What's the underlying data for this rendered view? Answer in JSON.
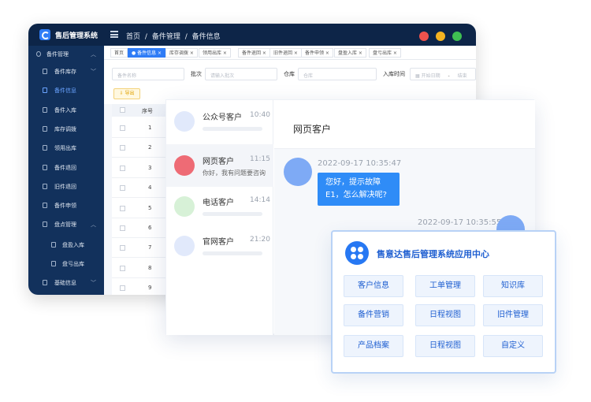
{
  "admin": {
    "app_title": "售后管理系统",
    "breadcrumb": [
      "首页",
      "/",
      "备件管理",
      "/",
      "备件信息"
    ],
    "window_dots": [
      "#f0524d",
      "#f5b321",
      "#3fbf52"
    ],
    "sidebar": [
      {
        "label": "备件管理",
        "level": "group",
        "chevron": "︿"
      },
      {
        "label": "备件库存",
        "level": "item",
        "chevron": "﹀"
      },
      {
        "label": "备件信息",
        "level": "item",
        "active": true
      },
      {
        "label": "备件入库",
        "level": "item"
      },
      {
        "label": "库存调拨",
        "level": "item"
      },
      {
        "label": "领用出库",
        "level": "item"
      },
      {
        "label": "备件退回",
        "level": "item"
      },
      {
        "label": "旧件退回",
        "level": "item"
      },
      {
        "label": "备件申领",
        "level": "item"
      },
      {
        "label": "盘点管理",
        "level": "item",
        "chevron": "︿"
      },
      {
        "label": "盘盈入库",
        "level": "sub"
      },
      {
        "label": "盘亏出库",
        "level": "sub"
      },
      {
        "label": "基础信息",
        "level": "item",
        "chevron": "﹀"
      }
    ],
    "tabs": [
      {
        "label": "首页"
      },
      {
        "label": "● 备件信息 ×",
        "active": true
      },
      {
        "label": "库存调拨 ×"
      },
      {
        "label": "领用出库 ×"
      },
      {
        "label": "备件退回 ×"
      },
      {
        "label": "旧件退回 ×"
      },
      {
        "label": "备件申领 ×"
      },
      {
        "label": "盘盈入库 ×"
      },
      {
        "label": "盘亏出库 ×"
      }
    ],
    "filters": {
      "part_name_placeholder": "备件名称",
      "batch_label": "批次",
      "batch_placeholder": "请输入批次",
      "warehouse_label": "仓库",
      "warehouse_placeholder": "仓库",
      "inbound_time_label": "入库时间",
      "start_date_placeholder": "开始日期",
      "range_sep": "-",
      "end_date_placeholder": "结束"
    },
    "export_label": "⇩ 导出",
    "table": {
      "header_no": "序号",
      "rows": [
        "1",
        "2",
        "3",
        "4",
        "5",
        "6",
        "7",
        "8",
        "9"
      ]
    }
  },
  "chat": {
    "conversations": [
      {
        "name": "公众号客户",
        "time": "10:40",
        "avatar_color": "#e1e9fb",
        "preview": ""
      },
      {
        "name": "网页客户",
        "time": "11:15",
        "avatar_color": "#ee6b75",
        "preview": "你好，我有问题要咨询",
        "active": true
      },
      {
        "name": "电话客户",
        "time": "14:14",
        "avatar_color": "#d7f1d7",
        "preview": ""
      },
      {
        "name": "官网客户",
        "time": "21:20",
        "avatar_color": "#e1e9fb",
        "preview": ""
      }
    ],
    "title": "网页客户",
    "messages": [
      {
        "time": "2022-09-17 10:35:47",
        "text": "您好，提示故障E1，怎么解决呢?"
      },
      {
        "time": "2022-09-17 10:35:55"
      }
    ]
  },
  "app_center": {
    "title": "售意达售后管理系统应用中心",
    "accent": "#2778f3",
    "apps": [
      "客户信息",
      "工单管理",
      "知识库",
      "备件营销",
      "日程视图",
      "旧件管理",
      "产品档案",
      "日程视图",
      "自定义"
    ]
  }
}
